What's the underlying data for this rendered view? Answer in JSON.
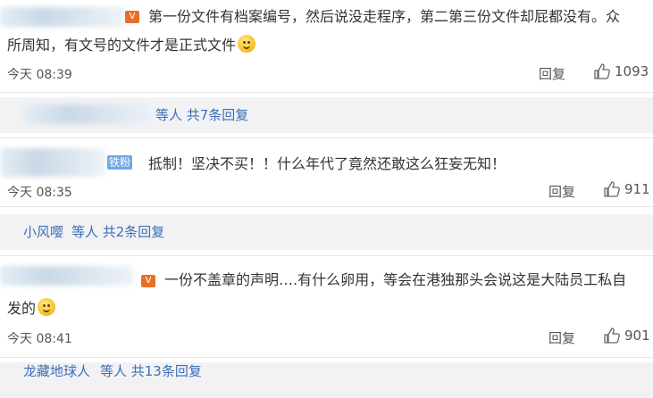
{
  "comments": [
    {
      "text_line1": "第一份文件有档案编号，然后说没走程序，第二第三份文件却屁都没有。众",
      "text_line2": "所周知，有文号的文件才是正式文件",
      "time": "今天 08:39",
      "reply_label": "回复",
      "likes": "1093"
    },
    {
      "badge": "铁粉",
      "text_line1": "抵制！坚决不买！！什么年代了竟然还敢这么狂妄无知！",
      "time": "今天 08:35",
      "reply_label": "回复",
      "likes": "911"
    },
    {
      "text_line1": "一份不盖章的声明….有什么卵用，等会在港独那头会说这是大陆员工私自",
      "text_line2": "发的",
      "time": "今天 08:41",
      "reply_label": "回复",
      "likes": "901"
    }
  ],
  "sub_threads": [
    {
      "suffix": "等人 共7条回复"
    },
    {
      "name": "小风嘤",
      "suffix": "等人 共2条回复"
    },
    {
      "name": "龙藏地球人",
      "suffix": "等人 共13条回复"
    }
  ],
  "icons": {
    "like": "thumbs-up-icon",
    "emoji": "smile-emoji-icon",
    "verified": "vip-badge-icon"
  },
  "colors": {
    "link": "#3a6fb4",
    "subthread_bg": "#f2f2f5",
    "vip": "#e86f28",
    "fans_badge": "#6fa8e8"
  }
}
